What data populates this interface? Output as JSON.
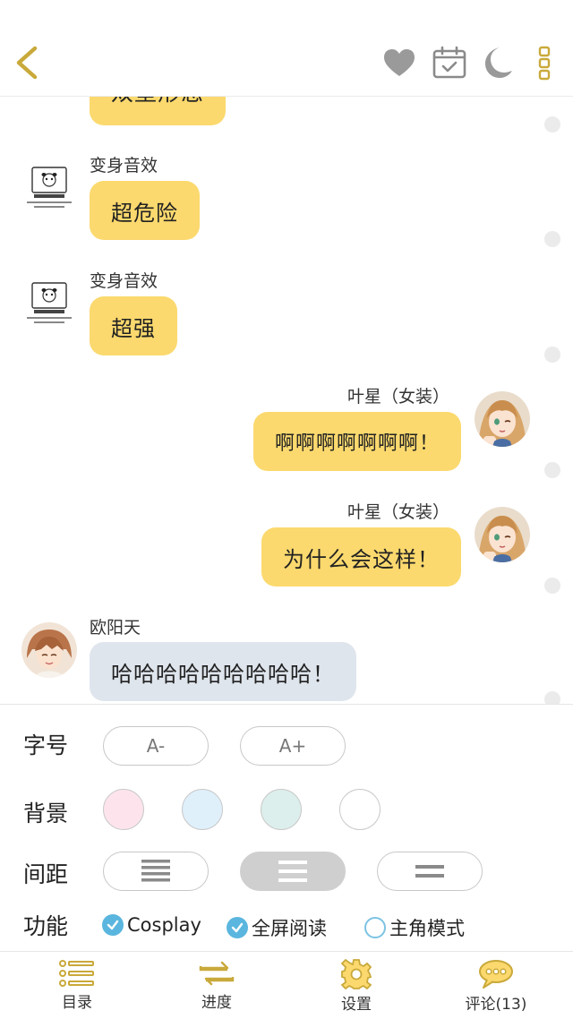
{
  "topbar": {
    "icons": [
      "back-arrow-icon",
      "heart-icon",
      "calendar-check-icon",
      "moon-icon",
      "more-vertical-icon"
    ],
    "accent_color": "#c9a93a"
  },
  "chat": {
    "messages": [
      {
        "side": "left",
        "sender": "",
        "text": "双壁形态",
        "style": "yellow",
        "partial": true
      },
      {
        "side": "left",
        "sender": "变身音效",
        "text": "超危险",
        "style": "yellow",
        "avatar": "sketch-avatar-icon"
      },
      {
        "side": "left",
        "sender": "变身音效",
        "text": "超强",
        "style": "yellow",
        "avatar": "sketch-avatar-icon"
      },
      {
        "side": "right",
        "sender": "叶星（女装）",
        "text": "啊啊啊啊啊啊啊！",
        "style": "yellow",
        "avatar": "anime-girl-avatar"
      },
      {
        "side": "right",
        "sender": "叶星（女装）",
        "text": "为什么会这样！",
        "style": "yellow",
        "avatar": "anime-girl-avatar"
      },
      {
        "side": "left",
        "sender": "欧阳天",
        "text": "哈哈哈哈哈哈哈哈哈！",
        "style": "gray",
        "avatar": "anime-boy-avatar"
      }
    ]
  },
  "settings": {
    "font_size": {
      "label": "字号",
      "decrease": "A-",
      "increase": "A+"
    },
    "background": {
      "label": "背景",
      "swatches": [
        "#fde4ec",
        "#dff0fb",
        "#dcefec",
        "#ffffff"
      ]
    },
    "spacing": {
      "label": "间距",
      "options": [
        "dense",
        "medium",
        "loose"
      ],
      "selected": "medium"
    },
    "functions": {
      "label": "功能",
      "items": [
        {
          "label": "Cosplay",
          "checked": true
        },
        {
          "label": "全屏阅读",
          "checked": true
        },
        {
          "label": "主角模式",
          "checked": false
        }
      ]
    }
  },
  "bottomnav": {
    "items": [
      {
        "label": "目录",
        "icon": "list-icon"
      },
      {
        "label": "进度",
        "icon": "swap-arrows-icon"
      },
      {
        "label": "设置",
        "icon": "gear-icon"
      },
      {
        "label": "评论(13)",
        "icon": "comment-bubble-icon"
      }
    ]
  }
}
